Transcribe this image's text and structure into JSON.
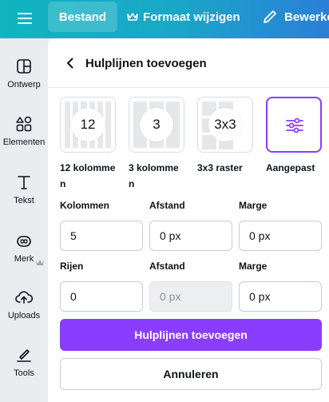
{
  "topbar": {
    "file_label": "Bestand",
    "resize_label": "Formaat wijzigen",
    "edit_label": "Bewerke"
  },
  "rail": {
    "items": [
      {
        "label": "Ontwerp",
        "icon": "layout-icon"
      },
      {
        "label": "Elementen",
        "icon": "shapes-icon"
      },
      {
        "label": "Tekst",
        "icon": "text-icon"
      },
      {
        "label": "Merk",
        "icon": "brand-icon"
      },
      {
        "label": "Uploads",
        "icon": "cloud-upload-icon"
      },
      {
        "label": "Tools",
        "icon": "tools-icon"
      }
    ]
  },
  "panel": {
    "title": "Hulplijnen toevoegen",
    "presets": [
      {
        "badge": "12",
        "label_line1": "12 kolomme",
        "label_line2": "n"
      },
      {
        "badge": "3",
        "label_line1": "3 kolomme",
        "label_line2": "n"
      },
      {
        "badge": "3x3",
        "label_line1": "3x3 raster",
        "label_line2": ""
      },
      {
        "badge": "",
        "label_line1": "Aangepast",
        "label_line2": "",
        "selected": true
      }
    ],
    "columns": {
      "label": "Kolommen",
      "value": "5",
      "gap_label": "Afstand",
      "gap_value": "0 px",
      "margin_label": "Marge",
      "margin_value": "0 px"
    },
    "rows": {
      "label": "Rijen",
      "value": "0",
      "gap_label": "Afstand",
      "gap_value": "0 px",
      "margin_label": "Marge",
      "margin_value": "0 px"
    },
    "add_button": "Hulplijnen toevoegen",
    "cancel_button": "Annuleren"
  },
  "colors": {
    "accent": "#8b3dff",
    "topbar_start": "#0fb5c0",
    "topbar_end": "#2b7ed8"
  }
}
